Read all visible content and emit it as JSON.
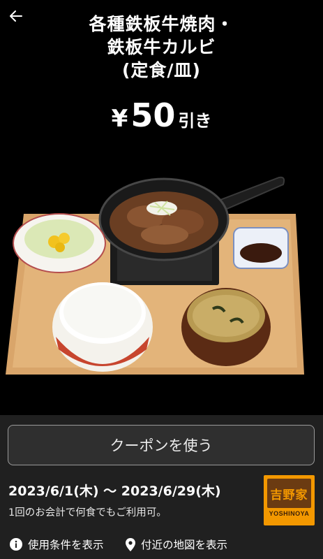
{
  "hero": {
    "title_line1": "各種鉄板牛焼肉・",
    "title_line2": "鉄板牛カルビ",
    "title_line3": "(定食/皿)",
    "discount_currency": "¥",
    "discount_amount": "50",
    "discount_suffix": "引き",
    "back_icon": "arrow-left-icon",
    "image_icon": "food-set-image"
  },
  "coupon": {
    "use_button_label": "クーポンを使う",
    "period": "2023/6/1(木) 〜 2023/6/29(木)",
    "note": "1回のお会計で何食でもご利用可。"
  },
  "brand": {
    "logo_text": "吉野家",
    "logo_en": "YOSHINOYA",
    "color_primary": "#f39800",
    "color_dark": "#6b3b12"
  },
  "links": {
    "terms_label": "使用条件を表示",
    "terms_icon": "info-icon",
    "map_label": "付近の地図を表示",
    "map_icon": "location-pin-icon"
  }
}
